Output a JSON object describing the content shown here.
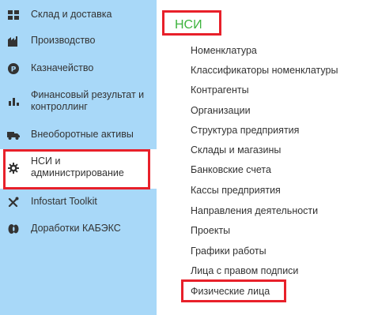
{
  "sidebar": {
    "items": [
      {
        "label": "Склад и доставка",
        "icon": "warehouse-icon"
      },
      {
        "label": "Производство",
        "icon": "factory-icon"
      },
      {
        "label": "Казначейство",
        "icon": "treasury-coin-icon"
      },
      {
        "label_line1": "Финансовый результат и",
        "label_line2": "контроллинг",
        "icon": "bar-chart-icon"
      },
      {
        "label": "Внеоборотные активы",
        "icon": "truck-icon"
      },
      {
        "label_line1": "НСИ и",
        "label_line2": "администрирование",
        "icon": "gear-icon"
      },
      {
        "label": "Infostart Toolkit",
        "icon": "tools-icon"
      },
      {
        "label": "Доработки КАБЭКС",
        "icon": "puzzle-icon"
      }
    ]
  },
  "main": {
    "title": "НСИ",
    "links": [
      "Номенклатура",
      "Классификаторы номенклатуры",
      "Контрагенты",
      "Организации",
      "Структура предприятия",
      "Склады и магазины",
      "Банковские счета",
      "Кассы предприятия",
      "Направления деятельности",
      "Проекты",
      "Графики работы",
      "Лица с правом подписи",
      "Физические лица"
    ]
  },
  "colors": {
    "sidebar_bg": "#a8d8f8",
    "title_green": "#3db33d",
    "highlight_red": "#e8202a"
  }
}
